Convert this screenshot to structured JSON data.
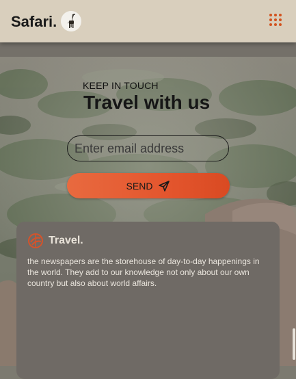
{
  "header": {
    "brand": "Safari.",
    "logo_icon": "giraffe-icon",
    "menu_icon": "grid-menu-icon",
    "accent": "#d2521e"
  },
  "newsletter": {
    "kicker": "KEEP IN TOUCH",
    "heading": "Travel with us",
    "email_placeholder": "Enter email address",
    "send_label": "SEND",
    "send_icon": "paper-plane-icon",
    "button_color": "#e4562e"
  },
  "footer_card": {
    "logo_icon": "travel-logo-icon",
    "title": "Travel.",
    "text": "the newspapers are the storehouse of day-to-day happenings in the world. They add to our knowledge not only about our own country but also about world affairs."
  }
}
